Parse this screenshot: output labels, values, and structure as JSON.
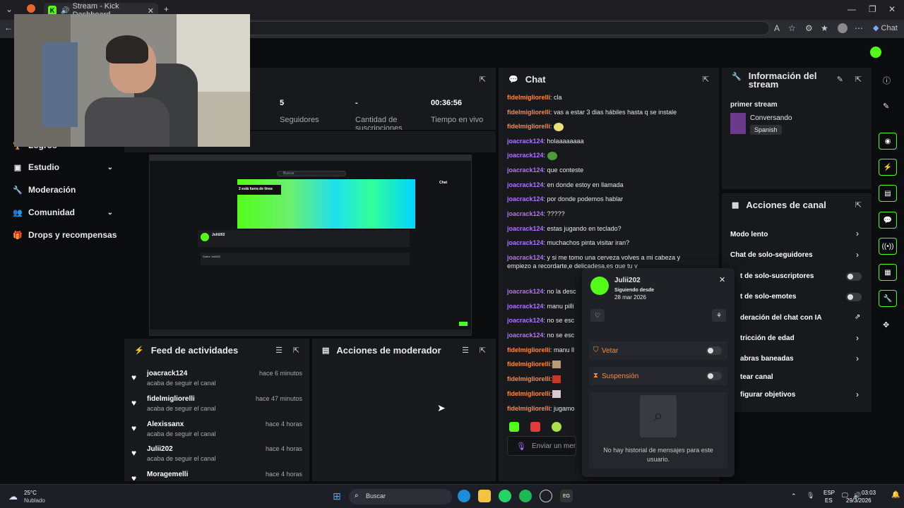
{
  "browser": {
    "active_tab_title": "Stream - Kick Dashboard",
    "chat_button": "Chat"
  },
  "sidebar": {
    "items": [
      {
        "label": "Logros",
        "icon": "trophy-icon",
        "chevron": false
      },
      {
        "label": "Estudio",
        "icon": "studio-icon",
        "chevron": true
      },
      {
        "label": "Moderación",
        "icon": "wrench-icon",
        "chevron": false
      },
      {
        "label": "Comunidad",
        "icon": "people-icon",
        "chevron": true
      },
      {
        "label": "Drops y recompensas",
        "icon": "gift-icon",
        "chevron": false
      }
    ]
  },
  "stats": {
    "followers_value": "5",
    "followers_label": "Seguidores",
    "subs_value": "-",
    "subs_label": "Cantidad de suscripciones",
    "live_value": "00:36:56",
    "live_label": "Tiempo en vivo"
  },
  "preview": {
    "offline_text": "2 está fuera de línea",
    "search_placeholder": "Buscar",
    "chat_label": "Chat",
    "user": "Julii202",
    "about": "Sobre Julii202"
  },
  "activity_feed": {
    "title": "Feed de actividades",
    "rows": [
      {
        "user": "joacrack124",
        "desc": "acaba de seguir el canal",
        "time": "hace 6 minutos"
      },
      {
        "user": "fidelmigliorelli",
        "desc": "acaba de seguir el canal",
        "time": "hace 47 minutos"
      },
      {
        "user": "Alexissanx",
        "desc": "acaba de seguir el canal",
        "time": "hace 4 horas"
      },
      {
        "user": "Julii202",
        "desc": "acaba de seguir el canal",
        "time": "hace 4 horas"
      },
      {
        "user": "Moragemelli",
        "desc": "",
        "time": "hace 4 horas"
      }
    ]
  },
  "mod_actions": {
    "title": "Acciones de moderador"
  },
  "chat": {
    "title": "Chat",
    "input_placeholder": "Enviar un mensaje",
    "messages": [
      {
        "user": "fidelmigliorelli",
        "color": "orange",
        "text": ": cla"
      },
      {
        "user": "fidelmigliorelli",
        "color": "orange",
        "text": ": vas a estar 3 dias hábiles hasta q se instale"
      },
      {
        "user": "fidelmigliorelli",
        "color": "orange",
        "text": ":"
      },
      {
        "user": "joacrack124",
        "color": "purple",
        "text": ": holaaaaaaaa"
      },
      {
        "user": "joacrack124",
        "color": "purple",
        "text": ":"
      },
      {
        "user": "joacrack124",
        "color": "purple",
        "text": ": que conteste"
      },
      {
        "user": "joacrack124",
        "color": "purple",
        "text": ": en donde estoy en llamada"
      },
      {
        "user": "joacrack124",
        "color": "purple",
        "text": ": por donde podemos hablar"
      },
      {
        "user": "joacrack124",
        "color": "purple",
        "text": ": ?????"
      },
      {
        "user": "joacrack124",
        "color": "purple",
        "text": ": estas jugando en teclado?"
      },
      {
        "user": "joacrack124",
        "color": "purple",
        "text": ": muchachos pinta visitar iran?"
      },
      {
        "user": "joacrack124",
        "color": "purple",
        "text": ": y si me tomo una cerveza volves a mi cabeza y empiezo a recordarte,e delicadesa,es que tu y"
      },
      {
        "user": "joacrack124",
        "color": "purple",
        "text": ": no la desc"
      },
      {
        "user": "joacrack124",
        "color": "purple",
        "text": ": manu pilli"
      },
      {
        "user": "joacrack124",
        "color": "purple",
        "text": ": no se esc"
      },
      {
        "user": "joacrack124",
        "color": "purple",
        "text": ": no se esc"
      },
      {
        "user": "fidelmigliorelli",
        "color": "orange",
        "text": ": manu ll"
      },
      {
        "user": "fidelmigliorelli",
        "color": "orange",
        "text": ":"
      },
      {
        "user": "fidelmigliorelli",
        "color": "orange",
        "text": ":"
      },
      {
        "user": "fidelmigliorelli",
        "color": "orange",
        "text": ":"
      },
      {
        "user": "fidelmigliorelli",
        "color": "orange",
        "text": ": jugamo"
      }
    ]
  },
  "stream_info": {
    "title": "Información del stream",
    "stream_title": "primer stream",
    "category": "Conversando",
    "language": "Spanish"
  },
  "channel_actions": {
    "title": "Acciones de canal",
    "items": [
      {
        "label": "Modo lento",
        "control": "chevron"
      },
      {
        "label": "Chat de solo-seguidores",
        "control": "chevron"
      },
      {
        "label": "t de solo-suscriptores",
        "control": "toggle"
      },
      {
        "label": "t de solo-emotes",
        "control": "toggle"
      },
      {
        "label": "deración del chat con IA",
        "control": "external"
      },
      {
        "label": "tricción de edad",
        "control": "chevron"
      },
      {
        "label": "abras baneadas",
        "control": "chevron"
      },
      {
        "label": "tear canal",
        "control": "none"
      },
      {
        "label": "figurar objetivos",
        "control": "chevron"
      }
    ]
  },
  "user_card": {
    "name": "Julii202",
    "following_label": "Siguiendo desde",
    "following_date": "28 mar 2026",
    "veto_label": "Vetar",
    "suspension_label": "Suspensión",
    "empty_history": "No hay historial de mensajes para este usuario."
  },
  "taskbar": {
    "weather_temp": "25°C",
    "weather_desc": "Nublado",
    "search": "Buscar",
    "lang_top": "ESP",
    "lang_bottom": "ES",
    "time": "03:03",
    "date": "29/3/2026"
  },
  "colors": {
    "kick_green": "#53fc18",
    "orange_user": "#ff8a3d",
    "purple_user": "#b372ff",
    "panel_bg": "#18191c"
  }
}
